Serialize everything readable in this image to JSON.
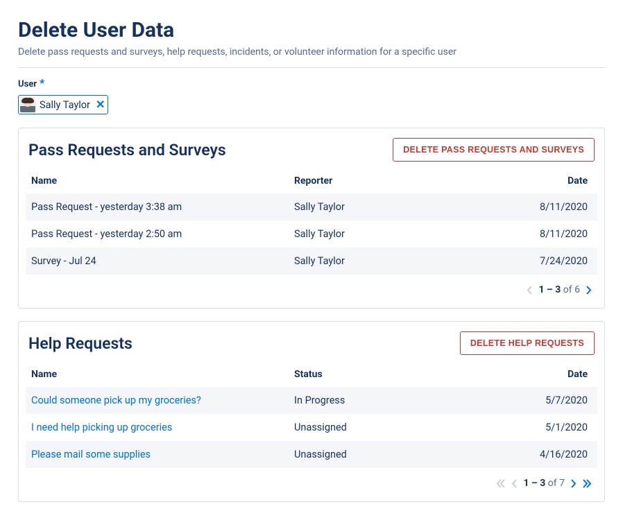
{
  "page": {
    "title": "Delete User Data",
    "subtitle": "Delete pass requests and surveys, help requests, incidents, or volunteer information for a specific user"
  },
  "userField": {
    "label": "User",
    "requiredMark": "*",
    "chip": {
      "name": "Sally Taylor"
    }
  },
  "panels": {
    "pass": {
      "title": "Pass Requests and Surveys",
      "deleteLabel": "DELETE PASS REQUESTS AND SURVEYS",
      "columns": {
        "name": "Name",
        "reporter": "Reporter",
        "date": "Date"
      },
      "rows": [
        {
          "name": "Pass Request - yesterday 3:38 am",
          "reporter": "Sally Taylor",
          "date": "8/11/2020"
        },
        {
          "name": "Pass Request - yesterday 2:50 am",
          "reporter": "Sally Taylor",
          "date": "8/11/2020"
        },
        {
          "name": "Survey - Jul 24",
          "reporter": "Sally Taylor",
          "date": "7/24/2020"
        }
      ],
      "pager": {
        "range": "1 – 3",
        "ofLabel": " of 6 "
      }
    },
    "help": {
      "title": "Help Requests",
      "deleteLabel": "DELETE HELP REQUESTS",
      "columns": {
        "name": "Name",
        "status": "Status",
        "date": "Date"
      },
      "rows": [
        {
          "name": "Could someone pick up my groceries?",
          "status": "In Progress",
          "date": "5/7/2020"
        },
        {
          "name": "I need help picking up groceries",
          "status": "Unassigned",
          "date": "5/1/2020"
        },
        {
          "name": "Please mail some supplies",
          "status": "Unassigned",
          "date": "4/16/2020"
        }
      ],
      "pager": {
        "range": "1 – 3",
        "ofLabel": " of 7 "
      }
    }
  }
}
